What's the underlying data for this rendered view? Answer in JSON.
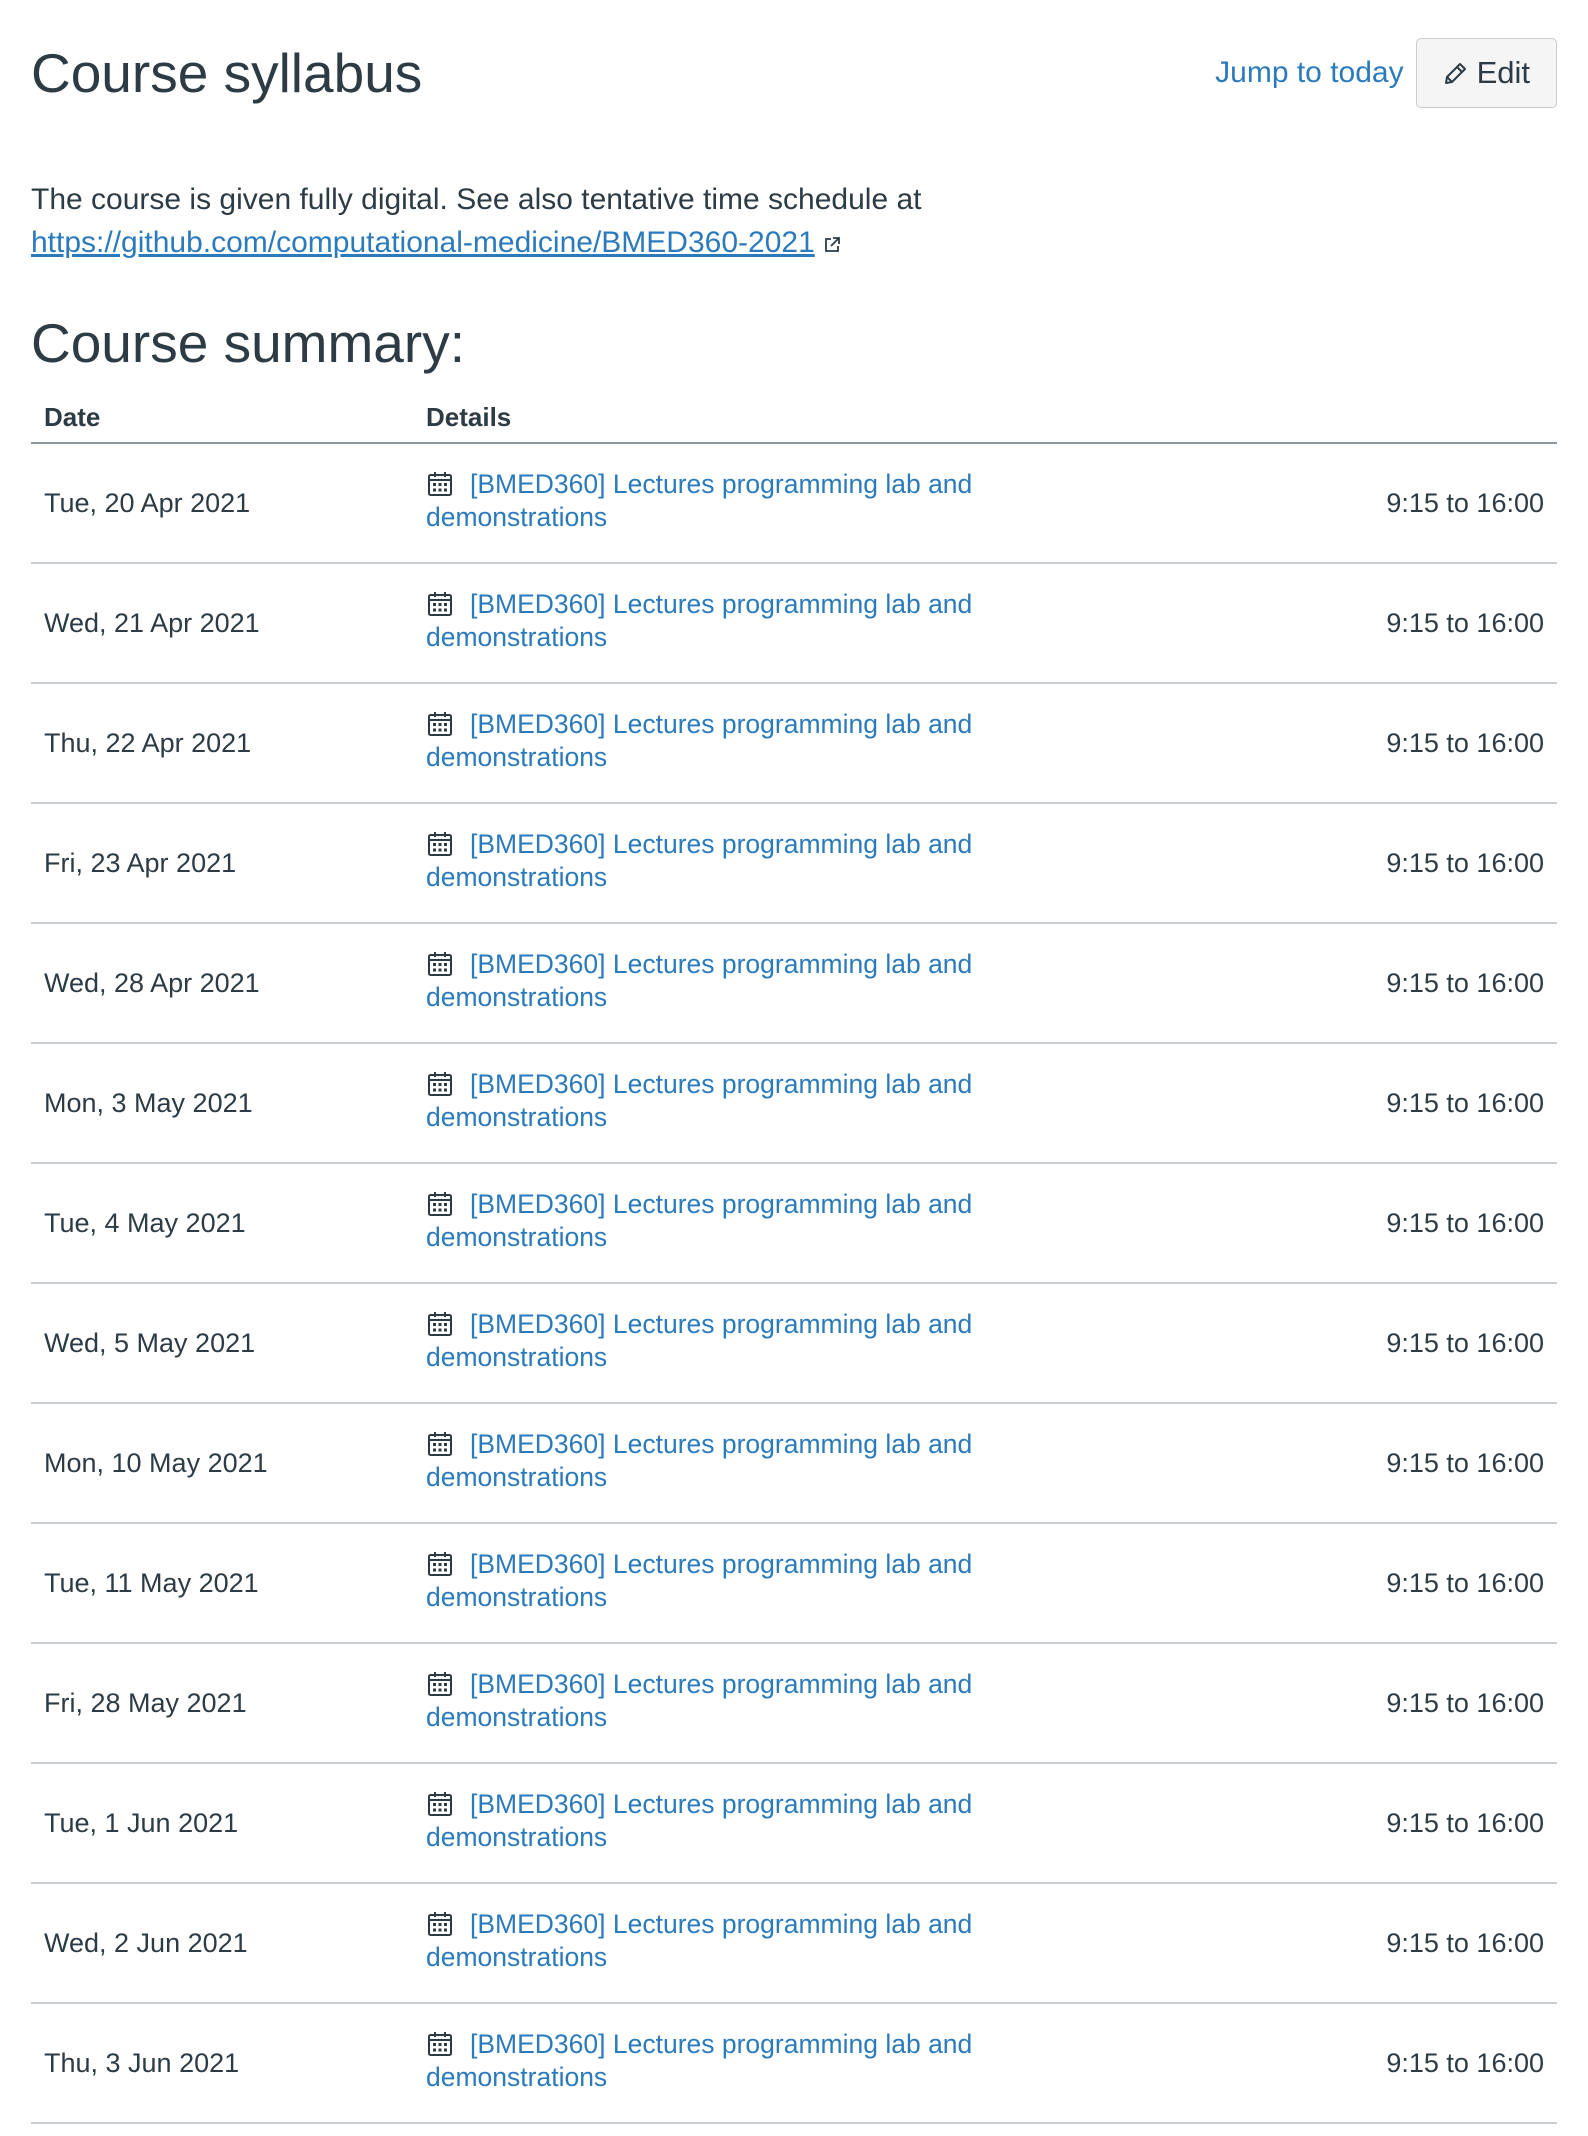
{
  "header": {
    "title": "Course syllabus",
    "jump_label": "Jump to today",
    "edit_label": "Edit"
  },
  "intro": {
    "text": "The course is given fully digital. See also tentative time schedule at ",
    "link_text": "https://github.com/computational-medicine/BMED360-2021"
  },
  "summary": {
    "heading": "Course summary:",
    "columns": [
      "Date",
      "Details"
    ],
    "rows": [
      {
        "date": "Tue, 20 Apr 2021",
        "event": "[BMED360] Lectures programming lab and demonstrations",
        "time": "9:15 to 16:00"
      },
      {
        "date": "Wed, 21 Apr 2021",
        "event": "[BMED360] Lectures programming lab and demonstrations",
        "time": "9:15 to 16:00"
      },
      {
        "date": "Thu, 22 Apr 2021",
        "event": "[BMED360] Lectures programming lab and demonstrations",
        "time": "9:15 to 16:00"
      },
      {
        "date": "Fri, 23 Apr 2021",
        "event": "[BMED360] Lectures programming lab and demonstrations",
        "time": "9:15 to 16:00"
      },
      {
        "date": "Wed, 28 Apr 2021",
        "event": "[BMED360] Lectures programming lab and demonstrations",
        "time": "9:15 to 16:00"
      },
      {
        "date": "Mon, 3 May 2021",
        "event": "[BMED360] Lectures programming lab and demonstrations",
        "time": "9:15 to 16:00"
      },
      {
        "date": "Tue, 4 May 2021",
        "event": "[BMED360] Lectures programming lab and demonstrations",
        "time": "9:15 to 16:00"
      },
      {
        "date": "Wed, 5 May 2021",
        "event": "[BMED360] Lectures programming lab and demonstrations",
        "time": "9:15 to 16:00"
      },
      {
        "date": "Mon, 10 May 2021",
        "event": "[BMED360] Lectures programming lab and demonstrations",
        "time": "9:15 to 16:00"
      },
      {
        "date": "Tue, 11 May 2021",
        "event": "[BMED360] Lectures programming lab and demonstrations",
        "time": "9:15 to 16:00"
      },
      {
        "date": "Fri, 28 May 2021",
        "event": "[BMED360] Lectures programming lab and demonstrations",
        "time": "9:15 to 16:00"
      },
      {
        "date": "Tue, 1 Jun 2021",
        "event": "[BMED360] Lectures programming lab and demonstrations",
        "time": "9:15 to 16:00"
      },
      {
        "date": "Wed, 2 Jun 2021",
        "event": "[BMED360] Lectures programming lab and demonstrations",
        "time": "9:15 to 16:00"
      },
      {
        "date": "Thu, 3 Jun 2021",
        "event": "[BMED360] Lectures programming lab and demonstrations",
        "time": "9:15 to 16:00"
      }
    ]
  },
  "icons": {
    "edit": "pencil-icon",
    "external_link": "external-link-icon",
    "event": "calendar-icon"
  },
  "colors": {
    "link": "#2b7abc",
    "text": "#2d3b45",
    "divider": "#c7cdd1"
  }
}
